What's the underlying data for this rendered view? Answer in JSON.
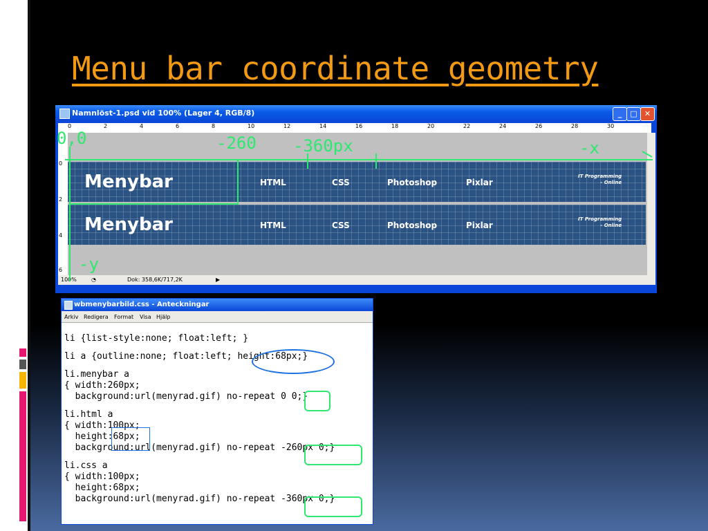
{
  "slide": {
    "title": "Menu bar coordinate geometry",
    "colors": {
      "title": "#f39a14",
      "annotation": "#2ee870",
      "blue_highlight": "#1b6fe0"
    }
  },
  "photoshop": {
    "window_title": "Namnlöst-1.psd vid 100% (Lager 4, RGB/8)",
    "ruler_top": [
      "0",
      "2",
      "4",
      "6",
      "8",
      "10",
      "12",
      "14",
      "16",
      "18",
      "20",
      "22",
      "24",
      "26",
      "28",
      "30"
    ],
    "ruler_left": [
      "0",
      "2",
      "4",
      "6"
    ],
    "menu_rows": [
      {
        "brand": "Menybar",
        "items": [
          "HTML",
          "CSS",
          "Photoshop",
          "Pixlar"
        ],
        "logo_line1": "IT Programming",
        "logo_line2": "- Online"
      },
      {
        "brand": "Menybar",
        "items": [
          "HTML",
          "CSS",
          "Photoshop",
          "Pixlar"
        ],
        "logo_line1": "IT Programming",
        "logo_line2": "- Online"
      }
    ],
    "status": {
      "zoom": "100%",
      "doc": "Dok: 358,6K/717,2K"
    },
    "annotations": {
      "origin": "0,0",
      "x260": "-260",
      "x360": "-360px",
      "x_axis": "-x",
      "y_axis": "-y"
    }
  },
  "notepad": {
    "window_title": "wbmenybarbild.css - Anteckningar",
    "menu": [
      "Arkiv",
      "Redigera",
      "Format",
      "Visa",
      "Hjälp"
    ],
    "lines": [
      "li {list-style:none; float:left; }",
      "",
      "li a {outline:none; float:left; height:68px;}",
      "",
      "li.menybar a",
      "{ width:260px;",
      "  background:url(menyrad.gif) no-repeat 0 0;}",
      "",
      "li.html a",
      "{ width:100px;",
      "  height:68px;",
      "  background:url(menyrad.gif) no-repeat -260px 0;}",
      "",
      "li.css a",
      "{ width:100px;",
      "  height:68px;",
      "  background:url(menyrad.gif) no-repeat -360px 0;}"
    ]
  }
}
